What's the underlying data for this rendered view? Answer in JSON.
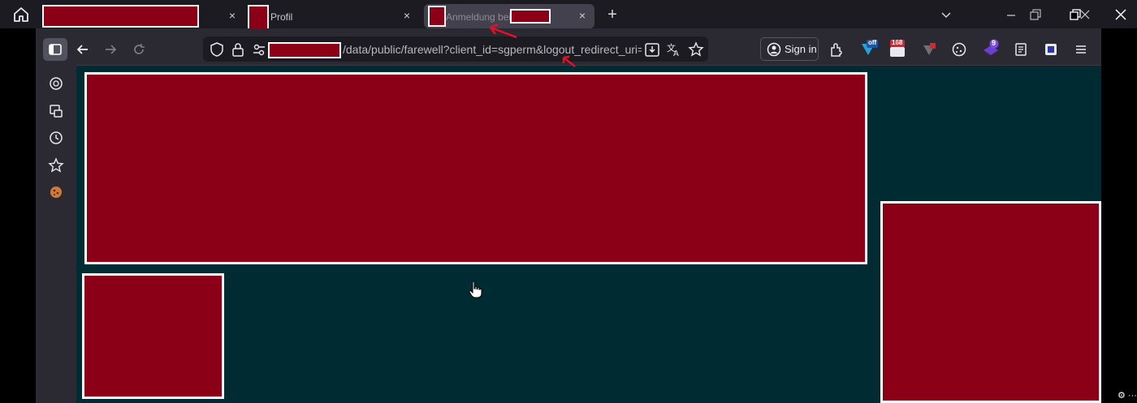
{
  "tabs": [
    {
      "title": ""
    },
    {
      "title": "Profil"
    },
    {
      "title": "Anmeldung bei"
    }
  ],
  "navbar": {
    "url_path": "/data/public/farewell?client_id=sgperm&logout_redirect_uri=h",
    "signin_label": "Sign in"
  },
  "badges": {
    "off_label": "off",
    "count_label": "168",
    "purple_count": "9"
  },
  "colors": {
    "tabstrip": "#1c1b22",
    "toolbar": "#2b2a33",
    "content_bg": "#002b32",
    "redaction": "#8b0017",
    "annotation": "#e0122a"
  },
  "icons": [
    "home-icon",
    "close-icon",
    "plus-icon",
    "chevron-down-icon",
    "minimize-icon",
    "restore-icon",
    "sidebar-icon",
    "back-arrow-icon",
    "forward-arrow-icon",
    "reload-icon",
    "shield-icon",
    "lock-icon",
    "permissions-icon",
    "download-page-icon",
    "translate-icon",
    "star-icon",
    "account-icon",
    "extensions-icon",
    "cookie-icon",
    "reader-icon",
    "menu-icon",
    "chatgpt-icon",
    "pointer-hand-icon"
  ]
}
